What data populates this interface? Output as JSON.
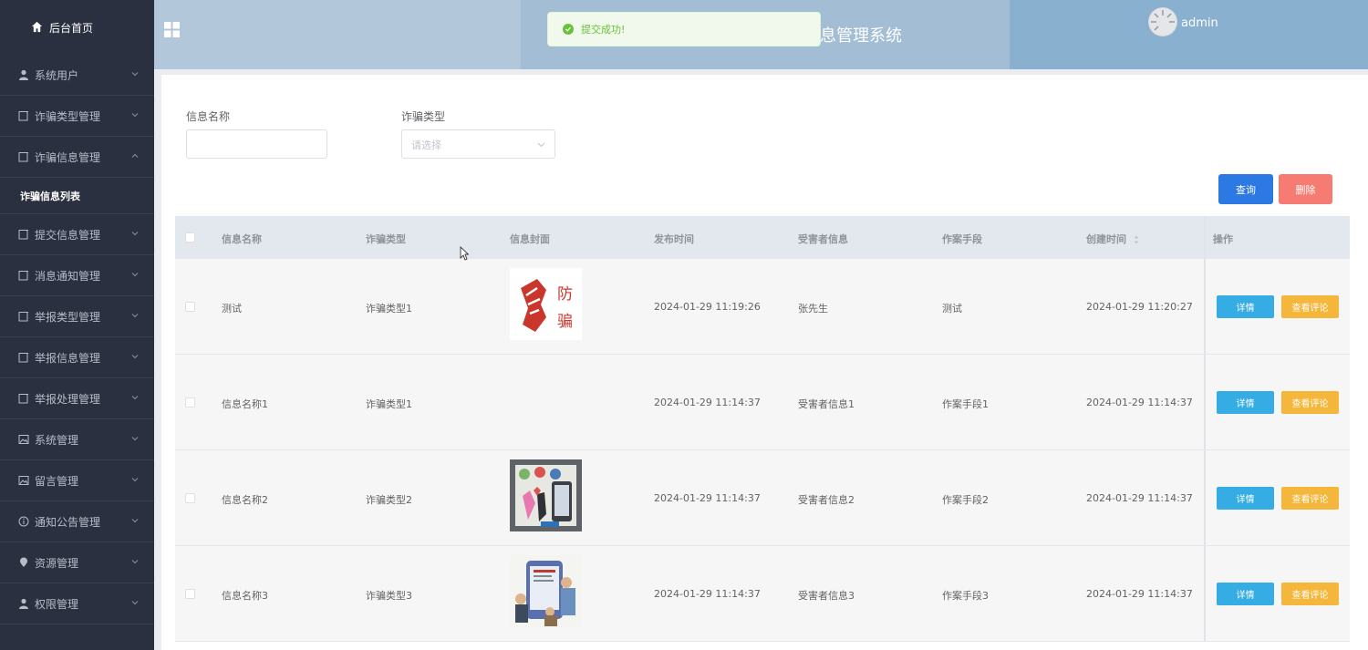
{
  "sidebar": {
    "home_label": "后台首页",
    "items": [
      {
        "label": "系统用户",
        "icon": "user-icon"
      },
      {
        "label": "诈骗类型管理",
        "icon": "document-icon"
      },
      {
        "label": "诈骗信息管理",
        "icon": "document-icon",
        "expanded": true
      },
      {
        "label": "提交信息管理",
        "icon": "document-icon"
      },
      {
        "label": "消息通知管理",
        "icon": "document-icon"
      },
      {
        "label": "举报类型管理",
        "icon": "document-icon"
      },
      {
        "label": "举报信息管理",
        "icon": "document-icon"
      },
      {
        "label": "举报处理管理",
        "icon": "document-icon"
      },
      {
        "label": "系统管理",
        "icon": "picture-icon"
      },
      {
        "label": "留言管理",
        "icon": "picture-icon"
      },
      {
        "label": "通知公告管理",
        "icon": "info-icon"
      },
      {
        "label": "资源管理",
        "icon": "location-icon"
      },
      {
        "label": "权限管理",
        "icon": "user-icon"
      }
    ],
    "submenu_active": "诈骗信息列表"
  },
  "header": {
    "title_visible": "息管理系统",
    "username": "admin"
  },
  "toast": {
    "message": "提交成功!"
  },
  "search": {
    "name_label": "信息名称",
    "name_value": "",
    "type_label": "诈骗类型",
    "type_placeholder": "请选择"
  },
  "buttons": {
    "query": "查询",
    "delete": "删除"
  },
  "table": {
    "headers": [
      "信息名称",
      "诈骗类型",
      "信息封面",
      "发布时间",
      "受害者信息",
      "作案手段",
      "创建时间",
      "操作"
    ],
    "detail_label": "详情",
    "comment_label": "查看评论",
    "rows": [
      {
        "name": "测试",
        "type": "诈骗类型1",
        "cover": "fist",
        "publish_time": "2024-01-29 11:19:26",
        "victim": "张先生",
        "method": "测试",
        "created": "2024-01-29 11:20:27"
      },
      {
        "name": "信息名称1",
        "type": "诈骗类型1",
        "cover": "none",
        "publish_time": "2024-01-29 11:14:37",
        "victim": "受害者信息1",
        "method": "作案手段1",
        "created": "2024-01-29 11:14:37"
      },
      {
        "name": "信息名称2",
        "type": "诈骗类型2",
        "cover": "cartoon-a",
        "publish_time": "2024-01-29 11:14:37",
        "victim": "受害者信息2",
        "method": "作案手段2",
        "created": "2024-01-29 11:14:37"
      },
      {
        "name": "信息名称3",
        "type": "诈骗类型3",
        "cover": "cartoon-b",
        "publish_time": "2024-01-29 11:14:37",
        "victim": "受害者信息3",
        "method": "作案手段3",
        "created": "2024-01-29 11:14:37"
      }
    ],
    "cover_text": "防骗"
  },
  "colors": {
    "sidebar_bg": "#2b3040",
    "header_bg": "#b2c7d9",
    "query_btn": "#2c79e4",
    "delete_btn": "#f67b73",
    "detail_btn": "#35ace4",
    "comment_btn": "#f5b73b",
    "success": "#67c23a"
  }
}
